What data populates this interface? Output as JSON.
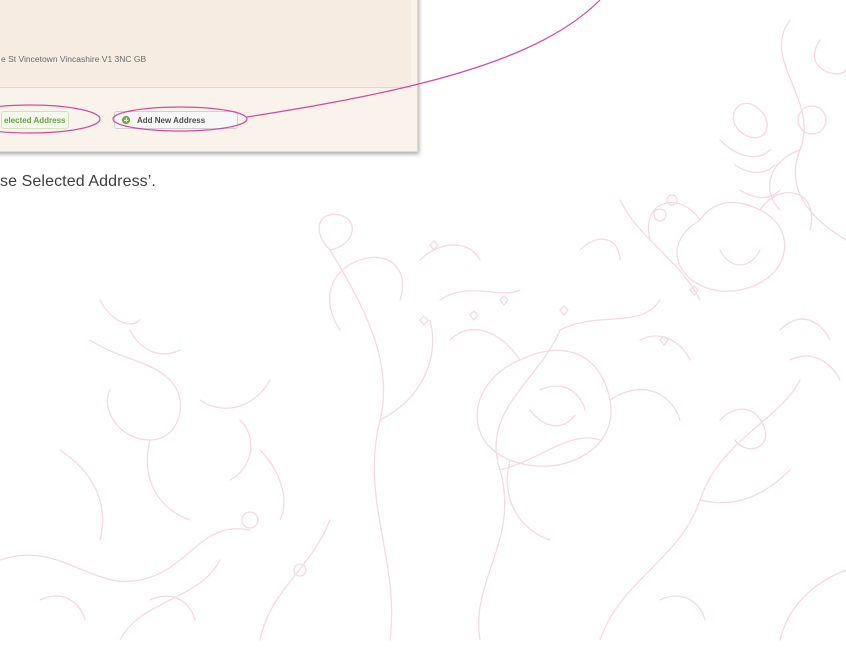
{
  "address_panel": {
    "address_line": "e St Vincetown Vincashire V1 3NC GB",
    "use_selected_button_label": "elected Address",
    "add_new_button_label": "Add New Address"
  },
  "caption": "se Selected Address’.",
  "colors": {
    "callout_line": "#d94a96",
    "floral": "#f5d9e6",
    "use_selected_text": "#6aa33e",
    "add_icon": "#7bbf4a"
  },
  "icons": {
    "add_icon": "plus-circle-icon"
  }
}
